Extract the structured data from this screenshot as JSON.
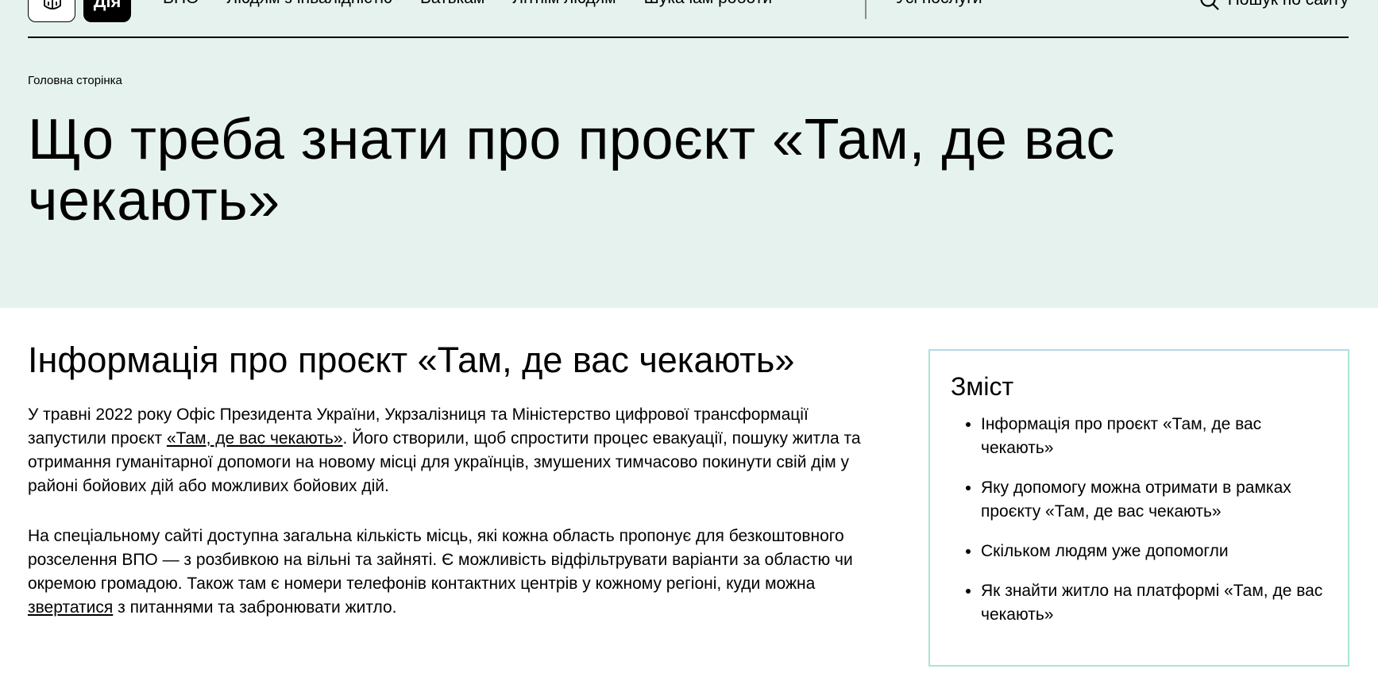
{
  "header": {
    "logo_diia": "Дія",
    "nav": [
      "ВПО",
      "Людям з інвалідністю",
      "Батькам",
      "Літнім людям",
      "Шукачам роботи"
    ],
    "all_services": "Усі послуги",
    "search_label": "Пошук по сайту"
  },
  "breadcrumb": "Головна сторінка",
  "page_title": "Що треба знати про проєкт «Там, де вас чекають»",
  "section": {
    "title": "Інформація про проєкт «Там, де вас чекають»",
    "p1_before": "У травні 2022 року Офіс Президента України, Укрзалізниця та Міністерство цифрової трансформації запустили проєкт ",
    "p1_link": "«Там, де вас чекають»",
    "p1_after": ". Його створили, щоб спростити процес евакуації, пошуку житла та отримання гуманітарної допомоги на новому місці для українців, змушених тимчасово покинути свій дім у районі бойових дій або можливих бойових дій.",
    "p2_before": "На спеціальному сайті доступна загальна кількість місць, які кожна область пропонує для безкоштовного розселення ВПО — з розбивкою на вільні та зайняті. Є можливість відфільтрувати варіанти за областю чи окремою громадою. Також там є номери телефонів контактних центрів у кожному регіоні, куди можна ",
    "p2_link": "звертатися",
    "p2_after": " з питаннями та забронювати житло."
  },
  "toc": {
    "title": "Зміст",
    "items": [
      "Інформація про проєкт «Там, де вас чекають»",
      "Яку допомогу можна отримати в рамках проєкту «Там, де вас чекають»",
      "Скільком людям уже допомогли",
      "Як знайти житло на платформі «Там, де вас чекають»"
    ]
  },
  "colors": {
    "hero_bg": "#e6f2ee",
    "toc_border": "#a8e6d4"
  }
}
